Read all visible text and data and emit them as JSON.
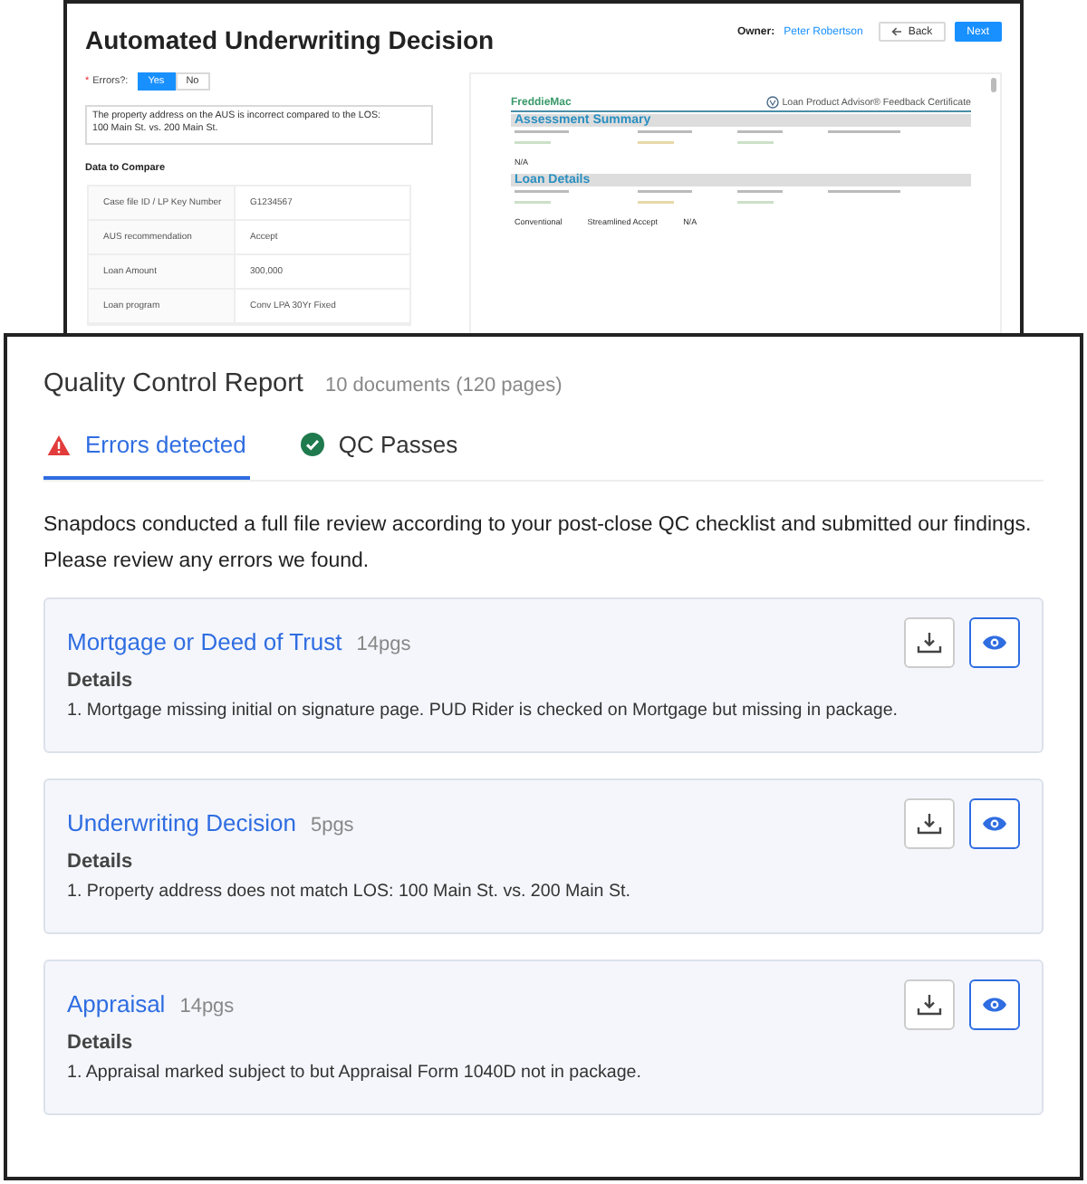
{
  "background_window": {
    "title": "Automated Underwriting Decision",
    "owner_label": "Owner:",
    "owner_name": "Peter Robertson",
    "buttons": [
      {
        "label": "Back",
        "kind": "back"
      },
      {
        "label": "Next",
        "kind": "primary"
      }
    ],
    "errors_question": {
      "required_mark": "*",
      "label": "Errors?:",
      "options": [
        {
          "label": "Yes",
          "selected": true
        },
        {
          "label": "No",
          "selected": false
        }
      ]
    },
    "comment": "The property address on the AUS is incorrect compared to the LOS:\n100 Main St. vs. 200 Main St.",
    "compare_heading": "Data to Compare",
    "compare_rows": [
      {
        "label": "Case file ID / LP Key Number",
        "value": "G1234567"
      },
      {
        "label": "AUS recommendation",
        "value": "Accept"
      },
      {
        "label": "Loan Amount",
        "value": "300,000"
      },
      {
        "label": "Loan program",
        "value": "Conv LPA 30Yr Fixed"
      }
    ],
    "document": {
      "logo": "FreddieMac",
      "header": "Loan Product Advisor® Feedback Certificate",
      "sections": [
        {
          "title": "Assessment Summary",
          "values": [
            "N/A"
          ]
        },
        {
          "title": "Loan Details",
          "values": [
            "Conventional",
            "Streamlined Accept",
            "N/A"
          ]
        }
      ]
    }
  },
  "report": {
    "title": "Quality Control Report",
    "subtitle": "10 documents (120 pages)",
    "tabs": [
      {
        "label": "Errors detected",
        "kind": "error",
        "selected": true
      },
      {
        "label": "QC Passes",
        "kind": "pass",
        "selected": false
      }
    ],
    "intro": "Snapdocs conducted a full file review according to your post-close QC checklist and submitted our findings. Please review any errors we found.",
    "documents": [
      {
        "name": "Mortgage or Deed of Trust",
        "pages": "14pgs",
        "details_label": "Details",
        "findings": [
          "1. Mortgage missing initial on signature page. PUD Rider is checked on Mortgage but missing in package."
        ]
      },
      {
        "name": "Underwriting Decision",
        "pages": "5pgs",
        "details_label": "Details",
        "findings": [
          "1. Property address does not match LOS: 100 Main St. vs. 200 Main St."
        ]
      },
      {
        "name": "Appraisal",
        "pages": "14pgs",
        "details_label": "Details",
        "findings": [
          "1. Appraisal marked subject to but Appraisal Form 1040D not in package."
        ]
      }
    ]
  }
}
